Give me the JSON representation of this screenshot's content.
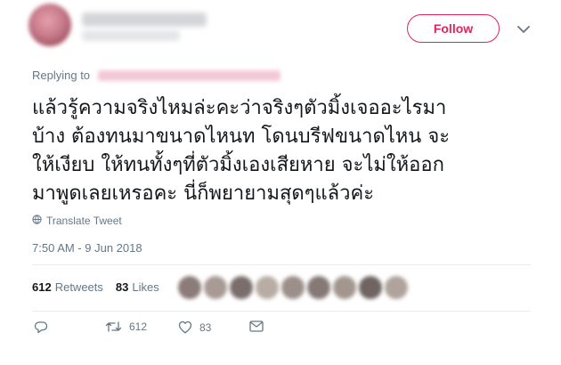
{
  "header": {
    "follow_label": "Follow"
  },
  "reply": {
    "label": "Replying to"
  },
  "tweet": {
    "lines": [
      "แล้วรู้ความจริงไหมล่ะคะว่าจริงๆตัวมิ้งเจออะไรมา",
      "บ้าง ต้องทนมาขนาดไหนท โดนบรีฟขนาดไหน จะ",
      "ให้เงียบ ให้ทนทั้งๆที่ตัวมิ้งเองเสียหาย จะไม่ให้ออก",
      "มาพูดเลยเหรอคะ นี่ก็พยายามสุดๆแล้วค่ะ"
    ],
    "translate_label": "Translate Tweet",
    "timestamp": "7:50 AM - 9 Jun 2018"
  },
  "stats": {
    "retweets_count": "612",
    "retweets_label": "Retweets",
    "likes_count": "83",
    "likes_label": "Likes"
  },
  "actions": {
    "retweet_count": "612",
    "like_count": "83"
  },
  "colors": {
    "accent": "#e0245e",
    "muted": "#657786",
    "text": "#14171a"
  },
  "icons": [
    "chevron-down-icon",
    "globe-icon",
    "reply-icon",
    "retweet-icon",
    "heart-icon",
    "mail-icon"
  ]
}
